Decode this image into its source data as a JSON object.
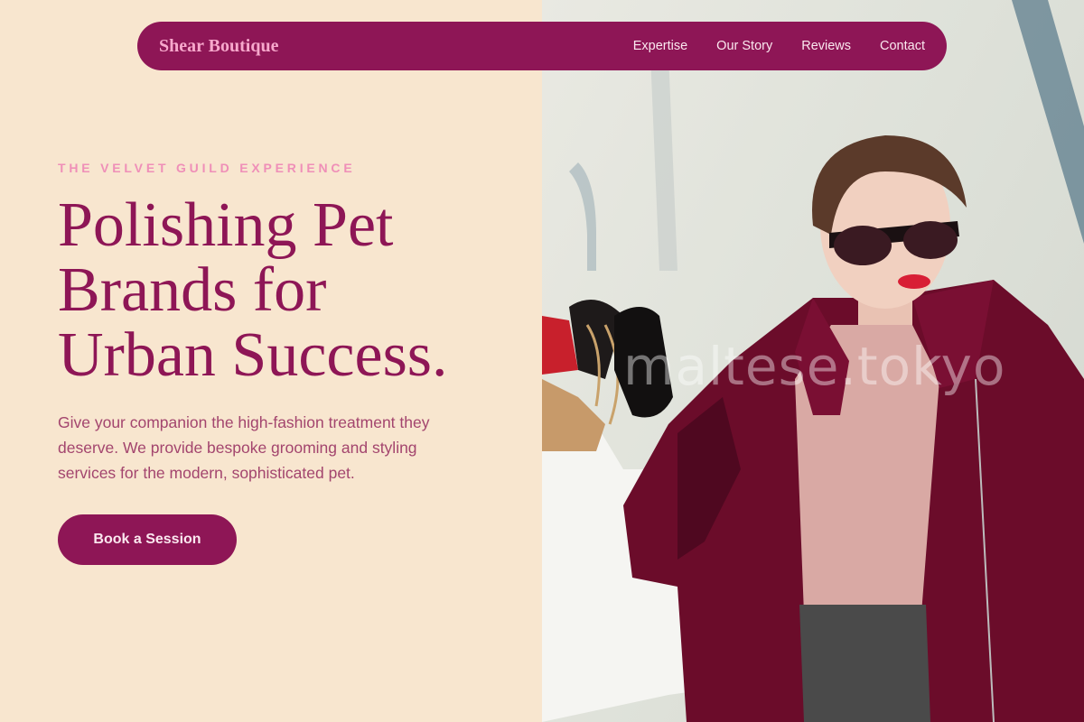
{
  "nav": {
    "brand": "Shear Boutique",
    "links": [
      "Expertise",
      "Our Story",
      "Reviews",
      "Contact"
    ]
  },
  "hero": {
    "eyebrow": "THE VELVET GUILD EXPERIENCE",
    "headline_lines": [
      "Polishing Pet",
      "Brands for",
      "Urban Success."
    ],
    "description": "Give your companion the high-fashion treatment they deserve. We provide bespoke grooming and styling services for the modern, sophisticated pet.",
    "cta_label": "Book a Session"
  },
  "image": {
    "watermark": "maltese.tokyo"
  },
  "colors": {
    "brand_primary": "#8e1656",
    "brand_pink": "#ef8fb8",
    "background": "#f8e6cf"
  }
}
